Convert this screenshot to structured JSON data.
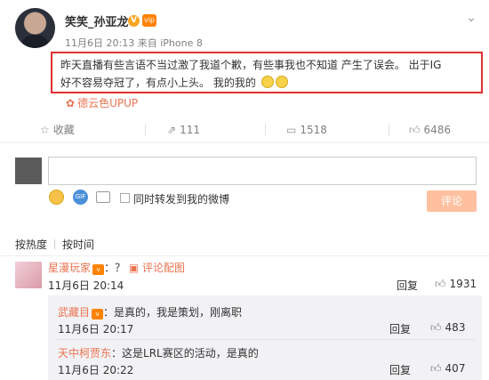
{
  "post": {
    "username": "笑笑_孙亚龙",
    "verified_badge": "V",
    "vip_badge": "vip",
    "menu_icon": "chevron-down-icon",
    "date": "11月6日 20:13",
    "source_prefix": "来自",
    "device": "iPhone 8",
    "content_line1": "昨天直播有些言语不当过激了我道个歉，有些事我也不知道 产生了误会。 出于IG",
    "content_line2": "好不容易夺冠了，有点小上头。 我的我的",
    "source_tag": "德云色UPUP"
  },
  "actions": {
    "collect_label": "收藏",
    "forward_count": "111",
    "comment_count": "1518",
    "like_count": "6486"
  },
  "composer": {
    "input_value": "",
    "forward_label": "同时转发到我的微博",
    "submit_label": "评论"
  },
  "sort": {
    "hot_label": "按热度",
    "time_label": "按时间"
  },
  "comments": [
    {
      "name": "星漫玩家",
      "text": "：？",
      "pic_link": "评论配图",
      "time": "11月6日 20:14",
      "reply_label": "回复",
      "likes": "1931"
    }
  ],
  "replies": [
    {
      "name": "武藏目",
      "text": "：是真的，我是策划，刚离职",
      "time": "11月6日 20:17",
      "reply_label": "回复",
      "likes": "483"
    },
    {
      "name": "天中柯贾东",
      "text": "：这是LRL赛区的活动，是真的",
      "time": "11月6日 20:22",
      "reply_label": "回复",
      "likes": "407"
    }
  ],
  "colors": {
    "highlight_border": "#e03030",
    "link_orange": "#eb7350",
    "submit_disabled": "#ffc09f"
  }
}
